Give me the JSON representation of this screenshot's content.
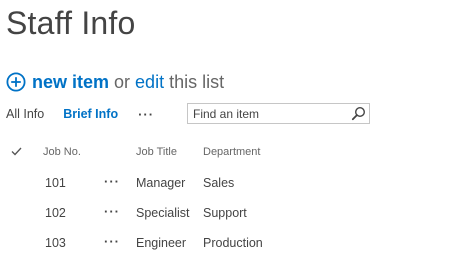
{
  "page": {
    "title": "Staff Info"
  },
  "actions": {
    "new_item_label": "new item",
    "or_text": "or",
    "edit_label": "edit",
    "this_list_text": "this list"
  },
  "views": {
    "all_label": "All Info",
    "brief_label": "Brief Info",
    "more_label": "···"
  },
  "search": {
    "placeholder": "Find an item",
    "value": ""
  },
  "table": {
    "headers": {
      "job_no": "Job No.",
      "job_title": "Job Title",
      "department": "Department"
    },
    "rows": [
      {
        "job_no": "101",
        "more": "···",
        "job_title": "Manager",
        "department": "Sales"
      },
      {
        "job_no": "102",
        "more": "···",
        "job_title": "Specialist",
        "department": "Support"
      },
      {
        "job_no": "103",
        "more": "···",
        "job_title": "Engineer",
        "department": "Production"
      }
    ]
  },
  "icons": {
    "add": "plus-circle-icon",
    "search": "magnifier-icon",
    "select_all": "checkmark-icon"
  },
  "colors": {
    "accent": "#0072c6",
    "text": "#444444",
    "muted": "#666666",
    "border": "#c6c6c6"
  }
}
